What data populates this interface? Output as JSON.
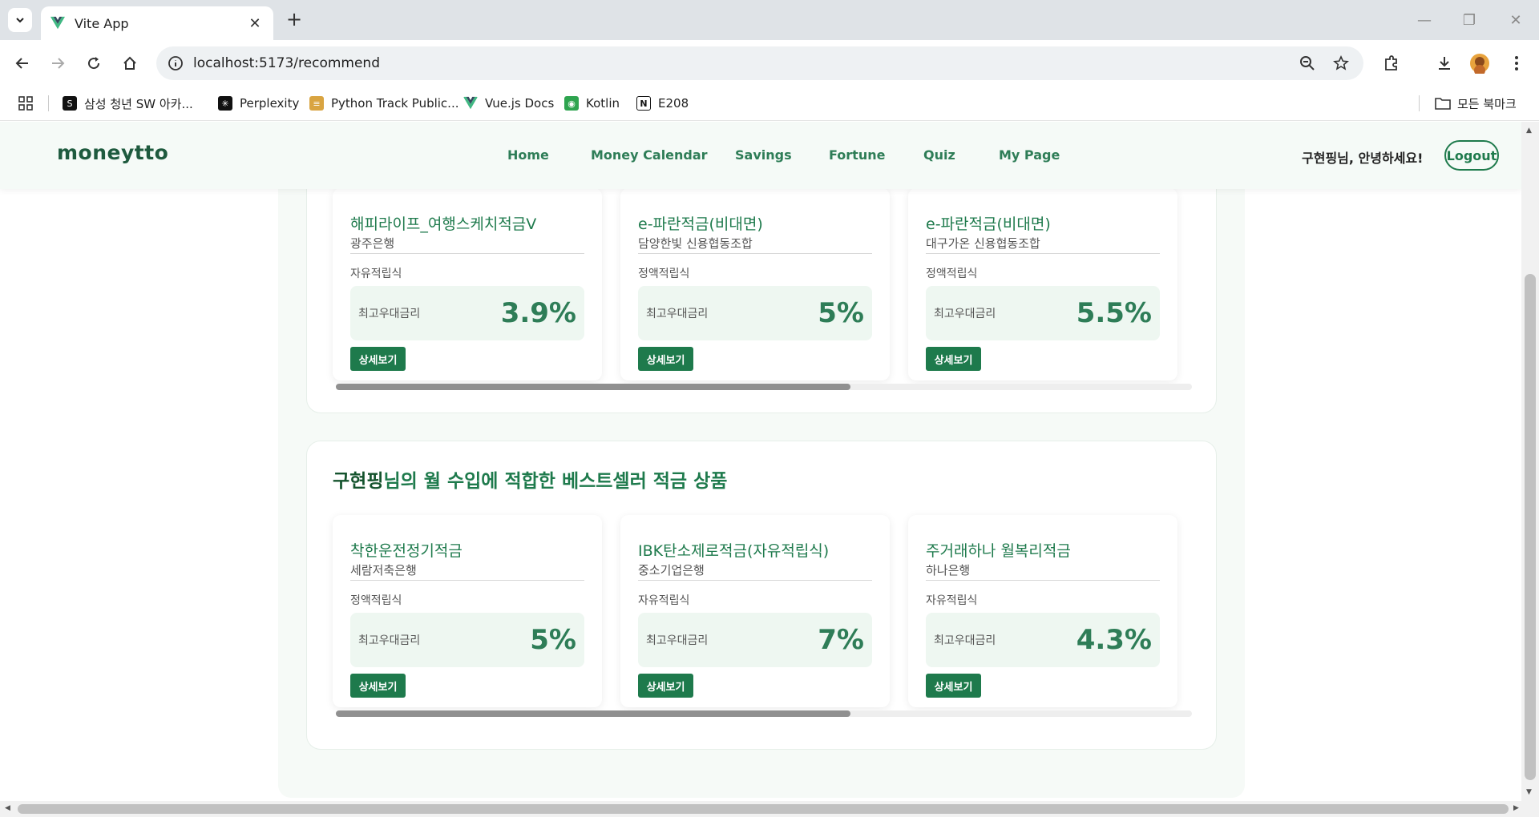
{
  "browser": {
    "tab_title": "Vite App",
    "url": "localhost:5173/recommend",
    "bookmarks": [
      {
        "label": "삼성 청년 SW 아카...",
        "icon": "samsung-icon",
        "color": "#111111"
      },
      {
        "label": "Perplexity",
        "icon": "perplexity-icon",
        "color": "#111111"
      },
      {
        "label": "Python Track Public...",
        "icon": "notebook-icon",
        "color": "#d9a441"
      },
      {
        "label": "Vue.js Docs",
        "icon": "vue-icon",
        "color": "#41b883"
      },
      {
        "label": "Kotlin",
        "icon": "kotlin-icon",
        "color": "#2ea44f"
      },
      {
        "label": "E208",
        "icon": "notion-icon",
        "color": "#111111"
      }
    ],
    "all_bookmarks": "모든 북마크"
  },
  "header": {
    "logo": "moneytto",
    "nav": [
      "Home",
      "Money Calendar",
      "Savings",
      "Fortune",
      "Quiz",
      "My Page"
    ],
    "greeting": "구현핑님, 안녕하세요!",
    "logout": "Logout"
  },
  "sections": [
    {
      "title_user": "",
      "title_rest": "",
      "cards": [
        {
          "name": "해피라이프_여행스케치적금V",
          "bank": "광주은행",
          "type": "자유적립식",
          "rate_label": "최고우대금리",
          "rate": "3.9%",
          "button": "상세보기"
        },
        {
          "name": "e-파란적금(비대면)",
          "bank": "담양한빛 신용협동조합",
          "type": "정액적립식",
          "rate_label": "최고우대금리",
          "rate": "5%",
          "button": "상세보기"
        },
        {
          "name": "e-파란적금(비대면)",
          "bank": "대구가온 신용협동조합",
          "type": "정액적립식",
          "rate_label": "최고우대금리",
          "rate": "5.5%",
          "button": "상세보기"
        }
      ]
    },
    {
      "title_user": "구현핑",
      "title_rest": "님의 월 수입에 적합한 베스트셀러 적금 상품",
      "cards": [
        {
          "name": "착한운전정기적금",
          "bank": "세람저축은행",
          "type": "정액적립식",
          "rate_label": "최고우대금리",
          "rate": "5%",
          "button": "상세보기"
        },
        {
          "name": "IBK탄소제로적금(자유적립식)",
          "bank": "중소기업은행",
          "type": "자유적립식",
          "rate_label": "최고우대금리",
          "rate": "7%",
          "button": "상세보기"
        },
        {
          "name": "주거래하나 월복리적금",
          "bank": "하나은행",
          "type": "자유적립식",
          "rate_label": "최고우대금리",
          "rate": "4.3%",
          "button": "상세보기"
        }
      ]
    }
  ],
  "colors": {
    "brand": "#1e7a4c",
    "brand_dark": "#14532d",
    "header_bg": "#f5faf7"
  }
}
